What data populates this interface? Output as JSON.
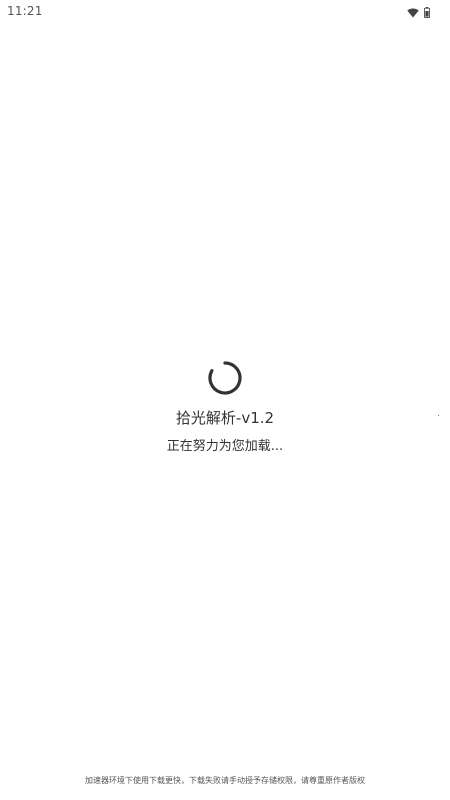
{
  "status_bar": {
    "time": "11:21",
    "icons": [
      "wifi-icon",
      "battery-icon"
    ]
  },
  "loading": {
    "spinner": "spinner-icon",
    "title": "拾光解析-v1.2",
    "message": "正在努力为您加载..."
  },
  "footer": {
    "note": "加速器环境下使用下载更快，下载失败请手动授予存储权限，请尊重原作者版权"
  },
  "colors": {
    "background": "#ffffff",
    "text": "#333333",
    "spinner": "#333333"
  }
}
